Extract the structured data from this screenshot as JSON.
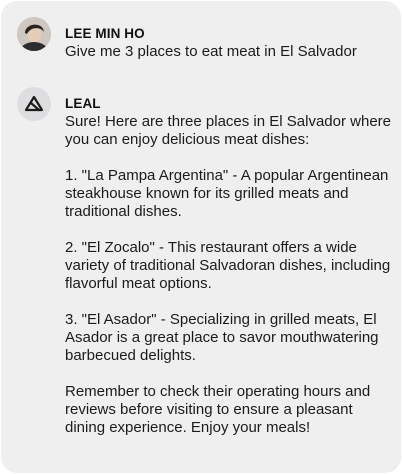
{
  "conversation": {
    "user_message": {
      "author": "LEE MIN HO",
      "text": "Give me 3 places to eat meat in El Salvador"
    },
    "assistant_message": {
      "author": "LEAL",
      "paragraphs": [
        "Sure! Here are three places in El Salvador where you can enjoy delicious meat dishes:",
        "1. \"La Pampa Argentina\" - A popular Argentinean steakhouse known for its grilled meats and traditional dishes.",
        "2. \"El Zocalo\" - This restaurant offers a wide variety of traditional Salvadoran dishes, including flavorful meat options.",
        "3. \"El Asador\" - Specializing in grilled meats, El Asador is a great place to savor mouthwatering barbecued delights.",
        "Remember to check their operating hours and reviews before visiting to ensure a pleasant dining experience. Enjoy your meals!"
      ]
    }
  },
  "icons": {
    "user_avatar": "user-avatar-photo",
    "assistant_logo": "triangle-logo-icon"
  },
  "colors": {
    "card_background": "#efeff0",
    "text": "#1b1b1b",
    "name": "#111111"
  }
}
